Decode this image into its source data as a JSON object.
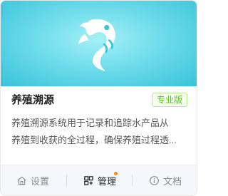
{
  "card": {
    "banner_icon": "fish-icon",
    "title": "养殖溯源",
    "badge": "专业版",
    "description_lines": [
      "养殖溯源系统用于记录和追踪水产品从",
      "养殖到收获的全过程，确保养殖过程透..."
    ]
  },
  "footer": {
    "settings": {
      "label": "设置",
      "icon": "home-icon"
    },
    "manage": {
      "label": "管理",
      "icon": "grid-icon",
      "has_notification": true
    },
    "docs": {
      "label": "文档",
      "icon": "info-icon"
    }
  },
  "colors": {
    "banner": "#6fdceb",
    "badge_text": "#52c41a",
    "notification_dot": "#fa8c16"
  }
}
